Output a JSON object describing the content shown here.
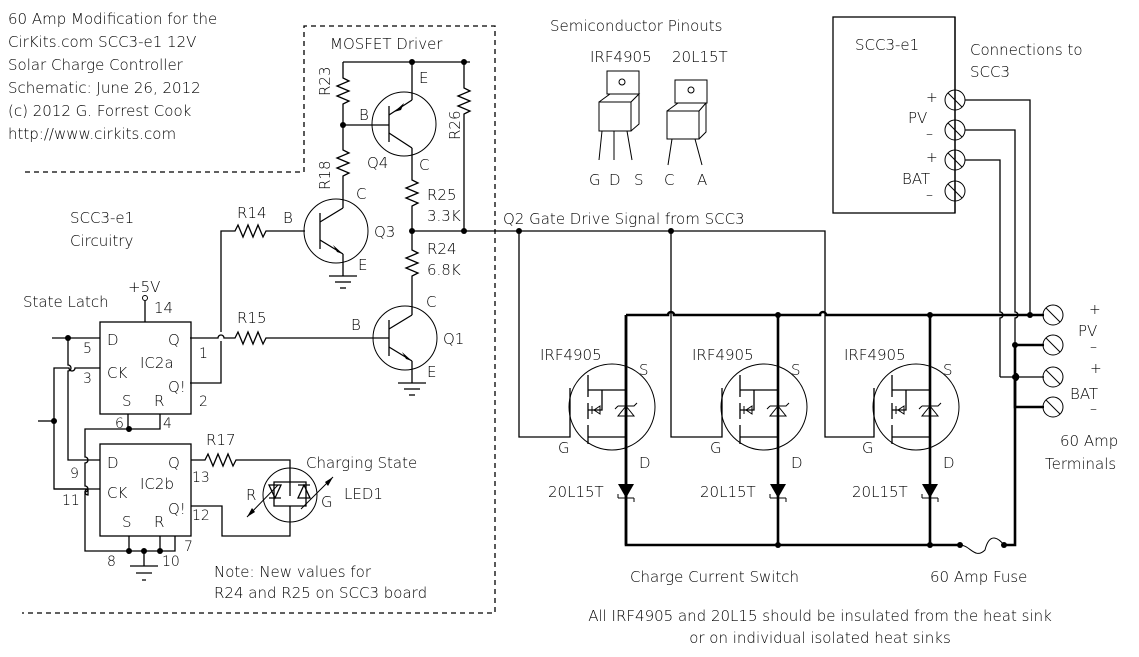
{
  "title_block": {
    "line1": "60 Amp Modification for the",
    "line2": "CirKits.com SCC3-e1  12V",
    "line3": "Solar Charge Controller",
    "line4": "Schematic: June 26, 2012",
    "line5": "(c) 2012  G. Forrest Cook",
    "line6": "http://www.cirkits.com"
  },
  "driver_box": {
    "title": "MOSFET  Driver",
    "note_line1": "Note: New values for",
    "note_line2": "R24 and R25  on SCC3 board"
  },
  "circuitry_label": {
    "line1": "SCC3-e1",
    "line2": "Circuitry"
  },
  "state_latch": {
    "label": "State Latch",
    "supply": "+5V",
    "ic2a": {
      "name": "IC2a",
      "pins": {
        "d": "D",
        "ck": "CK",
        "q": "Q",
        "qn": "Q!",
        "s": "S",
        "r": "R"
      },
      "pin_numbers": {
        "d": "5",
        "ck": "3",
        "q": "1",
        "qn": "2",
        "s": "6",
        "r": "4",
        "vcc": "14"
      }
    },
    "ic2b": {
      "name": "IC2b",
      "pins": {
        "d": "D",
        "ck": "CK",
        "q": "Q",
        "qn": "Q!",
        "s": "S",
        "r": "R"
      },
      "pin_numbers": {
        "d": "9",
        "ck": "11",
        "q": "13",
        "qn": "12",
        "s": "8",
        "r": "10",
        "gnd": "7"
      }
    }
  },
  "resistors": {
    "r14": "R14",
    "r15": "R15",
    "r17": "R17",
    "r18": "R18",
    "r23": "R23",
    "r26": "R26",
    "r25": "R25",
    "r25_value": "3.3K",
    "r24": "R24",
    "r24_value": "6.8K"
  },
  "transistors": {
    "q1": {
      "name": "Q1",
      "b": "B",
      "c": "C",
      "e": "E"
    },
    "q3": {
      "name": "Q3",
      "b": "B",
      "c": "C",
      "e": "E"
    },
    "q4": {
      "name": "Q4",
      "b": "B",
      "c": "C",
      "e": "E"
    }
  },
  "led": {
    "name": "LED1",
    "label": "Charging State",
    "red": "R",
    "green": "G"
  },
  "gate_signal_label": "Q2 Gate Drive Signal from SCC3",
  "pinouts": {
    "title": "Semiconductor Pinouts",
    "mosfet": {
      "name": "IRF4905",
      "pins": [
        "G",
        "D",
        "S"
      ]
    },
    "diode": {
      "name": "20L15T",
      "pins": [
        "C",
        "A"
      ]
    }
  },
  "switch_stages": [
    {
      "mosfet": "IRF4905",
      "diode": "20L15T",
      "s": "S",
      "g": "G",
      "d": "D"
    },
    {
      "mosfet": "IRF4905",
      "diode": "20L15T",
      "s": "S",
      "g": "G",
      "d": "D"
    },
    {
      "mosfet": "IRF4905",
      "diode": "20L15T",
      "s": "S",
      "g": "G",
      "d": "D"
    }
  ],
  "scc3_box": {
    "title": "SCC3-e1",
    "connections_label_line1": "Connections to",
    "connections_label_line2": "SCC3",
    "terminals": {
      "pv_plus": "+",
      "pv": "PV",
      "pv_minus": "–",
      "bat_plus": "+",
      "bat": "BAT",
      "bat_minus": "–"
    }
  },
  "amp_terminals": {
    "pv_plus": "+",
    "pv": "PV",
    "pv_minus": "–",
    "bat_plus": "+",
    "bat": "BAT",
    "bat_minus": "–",
    "label_line1": "60 Amp",
    "label_line2": "Terminals"
  },
  "switch_label": "Charge Current Switch",
  "fuse_label": "60 Amp Fuse",
  "footer": {
    "line1": "All IRF4905 and 20L15 should be insulated from the heat sink",
    "line2": "or on individual isolated heat sinks"
  }
}
